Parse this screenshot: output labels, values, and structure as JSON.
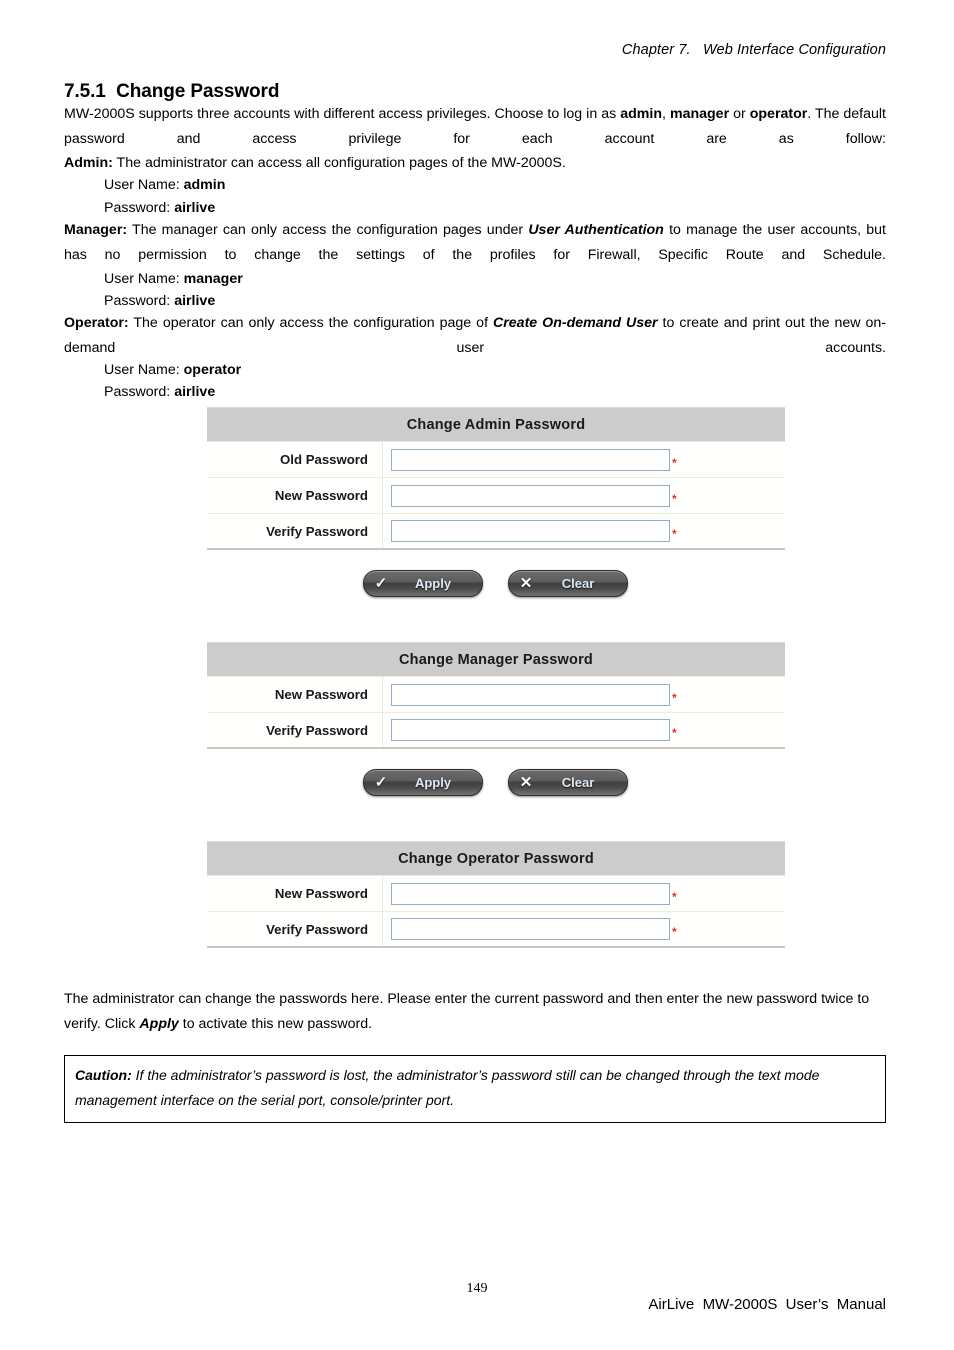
{
  "header": {
    "chapter": "Chapter 7.   Web Interface Configuration"
  },
  "section": {
    "number": "7.5.1",
    "title": "Change Password",
    "heading": "7.5.1  Change Password"
  },
  "intro": {
    "line1_a": "MW-2000S supports three accounts with different access privileges. Choose to log in as ",
    "line1_admin": "admin",
    "line1_b": ", ",
    "line1_manager": "manager",
    "line1_c": " or ",
    "line1_operator": "operator",
    "line1_d": ". The default password and access privilege for each account are as follow:"
  },
  "accounts": [
    {
      "role_label": "Admin:",
      "description": " The administrator can access all configuration pages of the MW-2000S.",
      "username_label": "User Name: ",
      "username_value": "admin",
      "password_label": "Password: ",
      "password_value": "airlive"
    },
    {
      "role_label": "Manager:",
      "description_a": " The manager can only access the configuration pages under ",
      "description_em": "User Authentication",
      "description_b": " to manage the user accounts, but has no permission to change the settings of the profiles for Firewall, Specific Route and Schedule.",
      "username_label": "User Name: ",
      "username_value": "manager",
      "password_label": "Password: ",
      "password_value": "airlive"
    },
    {
      "role_label": "Operator:",
      "description_a": " The operator can only access the configuration page of ",
      "description_em": "Create On-demand User",
      "description_b": " to create and print out the new on-demand user accounts.",
      "username_label": "User Name: ",
      "username_value": "operator",
      "password_label": "Password: ",
      "password_value": "airlive"
    }
  ],
  "screenshot": {
    "required_marker": "*",
    "panels": [
      {
        "title": "Change Admin Password",
        "rows": [
          {
            "label": "Old Password",
            "value": ""
          },
          {
            "label": "New Password",
            "value": ""
          },
          {
            "label": "Verify Password",
            "value": ""
          }
        ],
        "has_buttons": true,
        "apply_label": "Apply",
        "apply_glyph": "✓",
        "clear_label": "Clear",
        "clear_glyph": "✕"
      },
      {
        "title": "Change Manager Password",
        "rows": [
          {
            "label": "New Password",
            "value": ""
          },
          {
            "label": "Verify Password",
            "value": ""
          }
        ],
        "has_buttons": true,
        "apply_label": "Apply",
        "apply_glyph": "✓",
        "clear_label": "Clear",
        "clear_glyph": "✕"
      },
      {
        "title": "Change Operator Password",
        "rows": [
          {
            "label": "New Password",
            "value": ""
          },
          {
            "label": "Verify Password",
            "value": ""
          }
        ],
        "has_buttons": false
      }
    ]
  },
  "outro": {
    "text_a": "The administrator can change the passwords here. Please enter the current password and then enter the new password twice to verify. Click ",
    "text_em": "Apply",
    "text_b": " to activate this new password."
  },
  "caution": {
    "label": "Caution:",
    "text": " If the administrator’s password is lost, the administrator’s password still can be changed through the text mode management interface on the serial port, console/printer port."
  },
  "footer": {
    "page_number": "149",
    "manual": "AirLive  MW-2000S  User’s  Manual"
  }
}
